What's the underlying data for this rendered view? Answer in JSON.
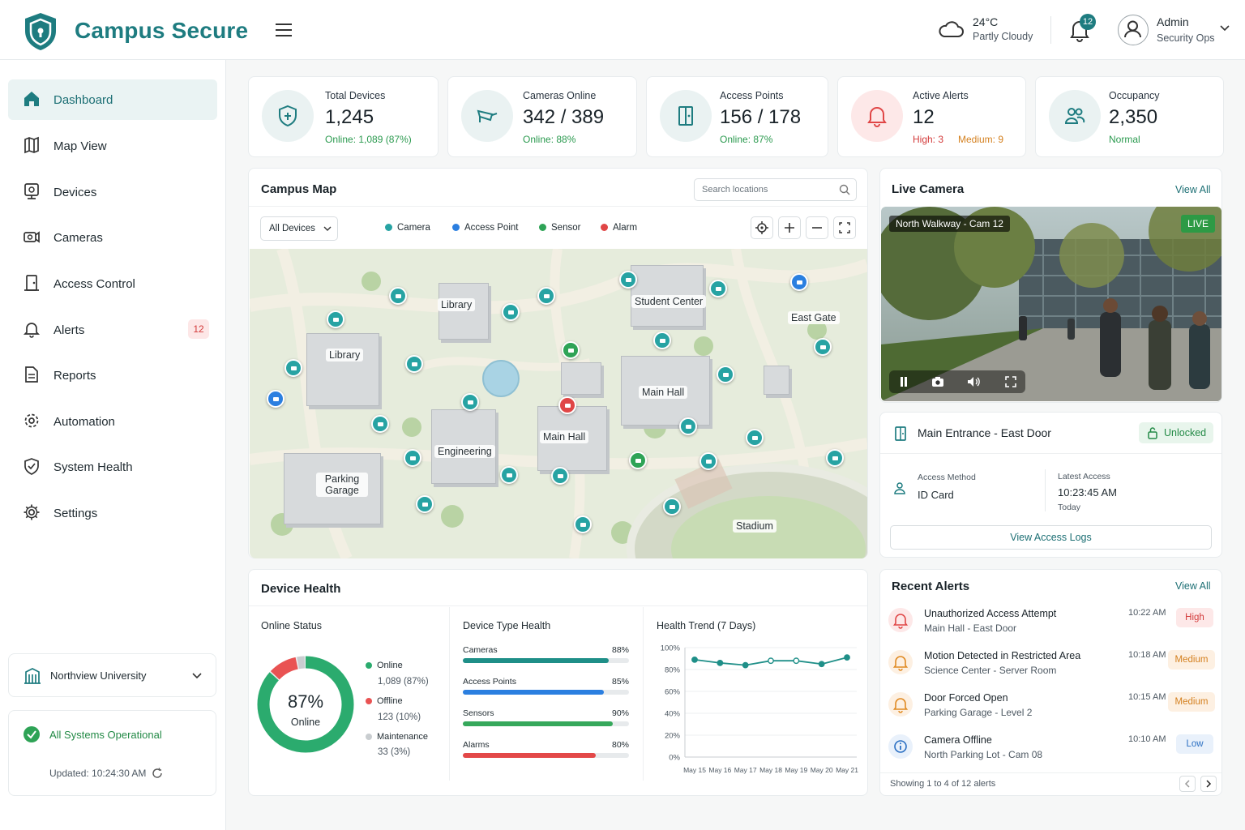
{
  "header": {
    "brand": "Campus Secure",
    "weather": {
      "temp": "24°C",
      "condition": "Partly Cloudy"
    },
    "notifications_count": "12",
    "user": {
      "name": "Admin",
      "role": "Security Ops"
    }
  },
  "sidebar": {
    "items": [
      {
        "label": "Dashboard",
        "icon": "home-icon"
      },
      {
        "label": "Map View",
        "icon": "map-icon"
      },
      {
        "label": "Devices",
        "icon": "device-icon"
      },
      {
        "label": "Cameras",
        "icon": "camera-icon"
      },
      {
        "label": "Access Control",
        "icon": "door-icon"
      },
      {
        "label": "Alerts",
        "icon": "bell-icon",
        "badge": "12"
      },
      {
        "label": "Reports",
        "icon": "report-icon"
      },
      {
        "label": "Automation",
        "icon": "gear-icon"
      },
      {
        "label": "System Health",
        "icon": "shield-check-icon"
      },
      {
        "label": "Settings",
        "icon": "settings-icon"
      }
    ],
    "org": "Northview University",
    "status": "All Systems Operational",
    "updated": "Updated: 10:24:30 AM"
  },
  "stats": [
    {
      "title": "Total Devices",
      "value": "1,245",
      "sub": "Online: 1,089 (87%)"
    },
    {
      "title": "Cameras Online",
      "value": "342 / 389",
      "sub": "Online: 88%"
    },
    {
      "title": "Access Points",
      "value": "156 / 178",
      "sub": "Online: 87%"
    },
    {
      "title": "Active Alerts",
      "value": "12",
      "sub_high": "High: 3",
      "sub_medium": "Medium: 9"
    },
    {
      "title": "Occupancy",
      "value": "2,350",
      "sub": "Normal"
    }
  ],
  "map": {
    "title": "Campus Map",
    "search_placeholder": "Search locations",
    "filter": "All Devices",
    "legend": [
      {
        "label": "Camera",
        "color": "#27a3a3"
      },
      {
        "label": "Access Point",
        "color": "#2b7fe0"
      },
      {
        "label": "Sensor",
        "color": "#2ea356"
      },
      {
        "label": "Alarm",
        "color": "#e04646"
      }
    ],
    "buildings": [
      "Library",
      "Library",
      "Student Center",
      "East Gate",
      "Main Hall",
      "Main Hall",
      "Engineering",
      "Parking Garage",
      "Stadium"
    ]
  },
  "live_camera": {
    "title": "Live Camera",
    "view_all": "View All",
    "feed_name": "North Walkway - Cam 12",
    "live": "LIVE"
  },
  "door": {
    "name": "Main Entrance - East Door",
    "status": "Unlocked",
    "method_label": "Access Method",
    "method": "ID Card",
    "latest_label": "Latest Access",
    "latest_time": "10:23:45 AM",
    "latest_day": "Today",
    "logs_button": "View Access Logs"
  },
  "device_health": {
    "title": "Device Health",
    "online_status": {
      "title": "Online Status",
      "percent": "87%",
      "center_label": "Online",
      "fraction": 0.87,
      "segments": [
        {
          "label": "Online",
          "value": "1,089 (87%)",
          "color": "#2bab6e",
          "fraction": 0.87
        },
        {
          "label": "Offline",
          "value": "123 (10%)",
          "color": "#e95353",
          "fraction": 0.1
        },
        {
          "label": "Maintenance",
          "value": "33 (3%)",
          "color": "#c9cdd0",
          "fraction": 0.03
        }
      ]
    },
    "type_health": {
      "title": "Device Type Health",
      "items": [
        {
          "label": "Cameras",
          "value": "88%",
          "fraction": 0.88,
          "color": "#1f8f88"
        },
        {
          "label": "Access Points",
          "value": "85%",
          "fraction": 0.85,
          "color": "#2b7fe0"
        },
        {
          "label": "Sensors",
          "value": "90%",
          "fraction": 0.9,
          "color": "#36a85b"
        },
        {
          "label": "Alarms",
          "value": "80%",
          "fraction": 0.8,
          "color": "#e34848"
        }
      ]
    }
  },
  "chart_data": {
    "type": "line",
    "title": "Health Trend (7 Days)",
    "x": [
      "May 15",
      "May 16",
      "May 17",
      "May 18",
      "May 19",
      "May 20",
      "May 21"
    ],
    "series": [
      {
        "values": [
          89,
          86,
          84,
          88,
          88,
          85,
          91
        ]
      }
    ],
    "yticks": [
      "100%",
      "80%",
      "60%",
      "40%",
      "20%",
      "0%"
    ],
    "ylim": [
      0,
      100
    ],
    "grid": true
  },
  "alerts": {
    "title": "Recent Alerts",
    "view_all": "View All",
    "items": [
      {
        "title": "Unauthorized Access Attempt",
        "location": "Main Hall - East Door",
        "time": "10:22 AM",
        "severity": "High"
      },
      {
        "title": "Motion Detected in Restricted Area",
        "location": "Science Center - Server Room",
        "time": "10:18 AM",
        "severity": "Medium"
      },
      {
        "title": "Door Forced Open",
        "location": "Parking Garage - Level 2",
        "time": "10:15 AM",
        "severity": "Medium"
      },
      {
        "title": "Camera Offline",
        "location": "North Parking Lot - Cam 08",
        "time": "10:10 AM",
        "severity": "Low"
      }
    ],
    "footer": "Showing 1 to 4 of 12 alerts"
  }
}
